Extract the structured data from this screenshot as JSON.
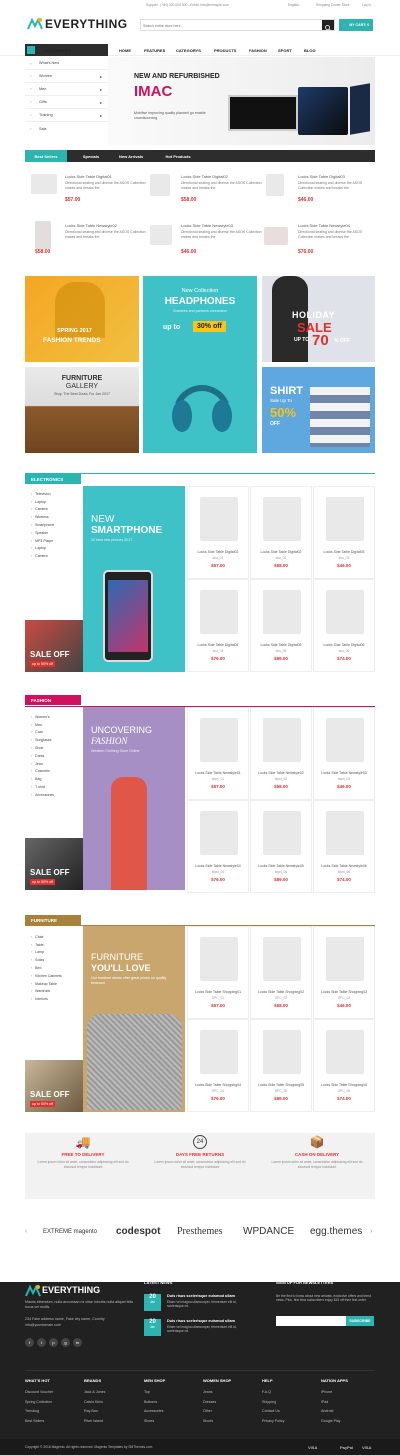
{
  "topbar": {
    "support": "Support : (+84) 900 000 000 - Email: Info@exmaple.com",
    "language": "English",
    "currency": "Shopping Center Store",
    "login": "Log in"
  },
  "header": {
    "logo": "EVERYTHING",
    "search_placeholder": "Search entire store here...",
    "cart": "MY CART: 0"
  },
  "nav": {
    "categories": "CATEGORIES",
    "items": [
      "HOME",
      "FEATURES",
      "CATEGORYS",
      "PRODUCTS",
      "FASHION",
      "SPORT",
      "BLOG"
    ]
  },
  "sidebar": [
    "What's New",
    "Women",
    "Men",
    "Gifts",
    "Training",
    "Sale"
  ],
  "hero": {
    "kicker": "NEW AND REFURBISHED",
    "title": "IMAC",
    "desc": "Mobilise improving quality planned go enable crowdsourcing."
  },
  "tabs": [
    "Best Sellers",
    "Specials",
    "New Arrivals",
    "Hot Products"
  ],
  "bestsellers": [
    {
      "name": "Locks Side Table Digital01",
      "desc": "Directional seating and diverse the ASOS Collection makes and breaks the",
      "price": "$57.00"
    },
    {
      "name": "Locks Side Table Digital02",
      "desc": "Directional seating and diverse the ASOS Collection makes and breaks the",
      "price": "$58.00"
    },
    {
      "name": "Locks Side Table Digital03",
      "desc": "Directional seating and diverse the ASOS Collection makes and breaks the",
      "price": "$46.00"
    },
    {
      "name": "Locks Side Table Newstyle02",
      "desc": "Directional seating and diverse the ASOS Collection makes and breaks the",
      "price": "$58.00"
    },
    {
      "name": "Locks Side Table Newstyle03",
      "desc": "Directional seating and diverse the ASOS Collection makes and breaks the",
      "price": "$46.00"
    },
    {
      "name": "Locks Side Table Newstyle04",
      "desc": "Directional seating and diverse the ASOS Collection makes and breaks the",
      "price": "$76.00"
    }
  ],
  "banners": {
    "spring": {
      "line1": "SPRING 2017",
      "line2": "FASHION TRENDS"
    },
    "headphones": {
      "small": "New Collection",
      "title": "HEADPHONES",
      "desc": "Grantees and partners connection",
      "upto": "up to",
      "off": "30% off"
    },
    "holiday": {
      "line1": "HOLIDAY",
      "line2": "SALE",
      "upto": "UP TO",
      "pct": "70",
      "off": "% OFF"
    },
    "furniture": {
      "line1": "FURNITURE",
      "line2": "GALLERY",
      "desc": "Shop The Best Deals For Jan 2017"
    },
    "shirt": {
      "title": "SHIRT",
      "sub": "Sale Up To",
      "pct": "50%",
      "off": "OFF"
    }
  },
  "electronics": {
    "title": "ELECTRONICS",
    "cats": [
      "Television",
      "Laptop",
      "Camera",
      "Wireless",
      "Smartphone",
      "Speaker",
      "MP3 Player",
      "Laptop",
      "Camera"
    ],
    "promo": {
      "line1": "NEW",
      "line2": "SMARTPHONE",
      "desc": "10 best new phones 2017"
    },
    "sale": {
      "t": "SALE OFF",
      "s": "up to 50% off"
    },
    "products": [
      {
        "name": "Locks Side Table Digital01",
        "sku": "sku_01",
        "price": "$57.00"
      },
      {
        "name": "Locks Side Table Digital02",
        "sku": "sku_02",
        "price": "$58.00"
      },
      {
        "name": "Locks Side Table Digital03",
        "sku": "sku_03",
        "price": "$46.00"
      },
      {
        "name": "Locks Side Table Digital04",
        "sku": "sku_04",
        "price": "$76.00"
      },
      {
        "name": "Locks Side Table Digital05",
        "sku": "sku_05",
        "price": "$89.00"
      },
      {
        "name": "Locks Side Table Digital06",
        "sku": "sku_06",
        "price": "$74.00"
      }
    ]
  },
  "fashion": {
    "title": "FASHION",
    "cats": [
      "Women's",
      "Men",
      "Coat",
      "Sunglasse",
      "Shoe",
      "Dress",
      "Jean",
      "Cosmetic",
      "Bag",
      "T-shirt",
      "Accessories"
    ],
    "promo": {
      "line1": "UNCOVERING",
      "line2": "FASHION",
      "desc": "Western Clothing Store Online"
    },
    "sale": {
      "t": "SALE OFF",
      "s": "up to 50% off"
    },
    "products": [
      {
        "name": "Locks Side Table Newstyle01",
        "sku": "styel_01",
        "price": "$57.00"
      },
      {
        "name": "Locks Side Table Newstyle02",
        "sku": "styel_02",
        "price": "$58.00"
      },
      {
        "name": "Locks Side Table Newstyle03",
        "sku": "styel_03",
        "price": "$46.00"
      },
      {
        "name": "Locks Side Table Newstyle04",
        "sku": "styel_04",
        "price": "$76.00"
      },
      {
        "name": "Locks Side Table Newstyle05",
        "sku": "styel_05",
        "price": "$89.00"
      },
      {
        "name": "Locks Side Table Newstyle06",
        "sku": "styel_06",
        "price": "$74.00"
      }
    ]
  },
  "furniture": {
    "title": "FURNITURE",
    "cats": [
      "Chair",
      "Table",
      "Lamp",
      "Sofas",
      "Bed",
      "Kitchen Cabinets",
      "Makeup Table",
      "Wardrobe",
      "Interiors"
    ],
    "promo": {
      "line1": "FURNITURE",
      "line2": "YOU'LL LOVE",
      "desc": "Our furniture stores offer great prices on quality bedroom"
    },
    "sale": {
      "t": "SALE OFF",
      "s": "up to 50% off"
    },
    "products": [
      {
        "name": "Locks Side Table Shopping01",
        "sku": "SPC_01",
        "price": "$57.00"
      },
      {
        "name": "Locks Side Table Shopping02",
        "sku": "SPC_02",
        "price": "$58.00"
      },
      {
        "name": "Locks Side Table Shopping03",
        "sku": "SPC_03",
        "price": "$46.00"
      },
      {
        "name": "Locks Side Table Shopping04",
        "sku": "SPC_04",
        "price": "$76.00"
      },
      {
        "name": "Locks Side Table Shopping05",
        "sku": "SPC_05",
        "price": "$89.00"
      },
      {
        "name": "Locks Side Table Shopping06",
        "sku": "SPC_06",
        "price": "$74.00"
      }
    ]
  },
  "features": [
    {
      "title": "FREE TO DELIVERY",
      "desc": "Lorem ipsum dolor sit amet, consectetur adipisicing elit sed do eiusmod tempor incididunt"
    },
    {
      "title": "DAYS FREE RETURNS",
      "num": "24",
      "desc": "Lorem ipsum dolor sit amet, consectetur adipisicing elit sed do eiusmod tempor incididunt"
    },
    {
      "title": "CASH ON DELIVERY",
      "desc": "Lorem ipsum dolor sit amet, consectetur adipisicing elit sed do eiusmod tempor incididunt"
    }
  ],
  "brands": [
    "EXTREME magento",
    "codespot",
    "Presthemes",
    "WPDANCE",
    "egg.themes"
  ],
  "footer": {
    "logo": "EVERYTHING",
    "about": "Mauris bibendum, nulla accumsan mi vitae lobortis nulla aliquet felis locus vel mollis.",
    "address": "234 Fake address name, Fake city name, Country",
    "email": "info@yourdomain.com",
    "news_title": "LATEST NEWS",
    "news": [
      {
        "day": "20",
        "mon": "Jan",
        "title": "Duis risus scelerisque euismod ullam",
        "desc": "Etiam vel magna ullamcorper, fermentum elit id, scelerisque mi."
      },
      {
        "day": "20",
        "mon": "Jan",
        "title": "Duis risus scelerisque euismod ullam",
        "desc": "Etiam vel magna ullamcorper, fermentum elit id, scelerisque mi."
      }
    ],
    "newsletter_title": "SIGN UP FOR NEWSLETTERS",
    "newsletter_desc": "Be the first to know about new arrivals, exclusive offers and trend news. Plus, first time subscribers enjoy $15 off their first order.",
    "subscribe": "SUBSCRIBE",
    "cols": [
      {
        "h": "WHAT'S HOT",
        "items": [
          "Discount Voucher",
          "Spring Collection",
          "Trending",
          "Best Sellers"
        ]
      },
      {
        "h": "BRANDS",
        "items": [
          "Jack & Jones",
          "Calvin Klein",
          "Ray Ban",
          "River Island"
        ]
      },
      {
        "h": "MEN SHOP",
        "items": [
          "Top",
          "Bottoms",
          "Accessories",
          "Shoes"
        ]
      },
      {
        "h": "WOMEN SHOP",
        "items": [
          "Jeans",
          "Dresses",
          "Other",
          "Shoes"
        ]
      },
      {
        "h": "HELP",
        "items": [
          "F.A.Q",
          "Shipping",
          "Contact Us",
          "Privacy Policy"
        ]
      },
      {
        "h": "NATION APPS",
        "items": [
          "iPhone",
          "iPad",
          "Android",
          "Google Play"
        ]
      }
    ],
    "copyright": "Copyright © 2016 Magento. All rights reserved. Magento Templates by SMThemes.com",
    "payments": [
      "VISA",
      "PayPal",
      "VISA"
    ]
  },
  "colors": {
    "teal": "#2cb5b0",
    "red": "#e0312d",
    "pink": "#d0115e",
    "gold": "#a8813a",
    "dark": "#2d2d2d"
  }
}
